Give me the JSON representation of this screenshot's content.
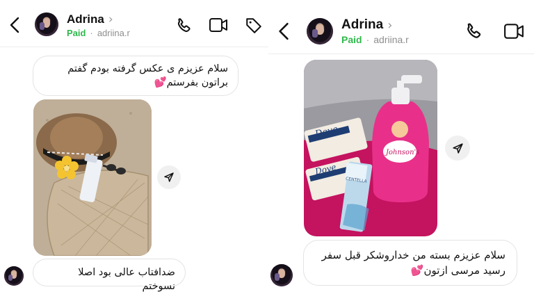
{
  "left": {
    "header": {
      "name": "Adrina",
      "chevron": "›",
      "paid": "Paid",
      "separator": "·",
      "handle": "adriina.r",
      "icons": [
        "back-icon",
        "phone-icon",
        "video-icon",
        "tag-icon"
      ]
    },
    "messages": [
      {
        "type": "text",
        "text": "سلام عزیزم ی عکس گرفته بودم گفتم براتون بفرستم",
        "emoji": "💕"
      },
      {
        "type": "image",
        "description_icon": "photo-hat-beach-bag-sunscreen"
      },
      {
        "type": "text",
        "text": "ضدافتاب عالی بود اصلا نسوختم"
      }
    ]
  },
  "right": {
    "header": {
      "name": "Adrina",
      "chevron": "›",
      "paid": "Paid",
      "separator": "·",
      "handle": "adriina.r",
      "icons": [
        "back-icon",
        "phone-icon",
        "video-icon"
      ]
    },
    "messages": [
      {
        "type": "image",
        "description_icon": "photo-dove-johnsons-products"
      },
      {
        "type": "text",
        "text": "سلام عزیزم بسته من خداروشکر قبل سفر رسید مرسی ازتون",
        "emoji": "💕"
      }
    ],
    "product_labels": [
      "Dove",
      "Dove",
      "Johnson's",
      "CENTELLA"
    ]
  },
  "colors": {
    "paid": "#2fb84c",
    "handle": "#8e8e8e",
    "bubble_border": "#e3e3e3",
    "share_bg": "#f0f0f0",
    "emoji": "#e2418b"
  }
}
